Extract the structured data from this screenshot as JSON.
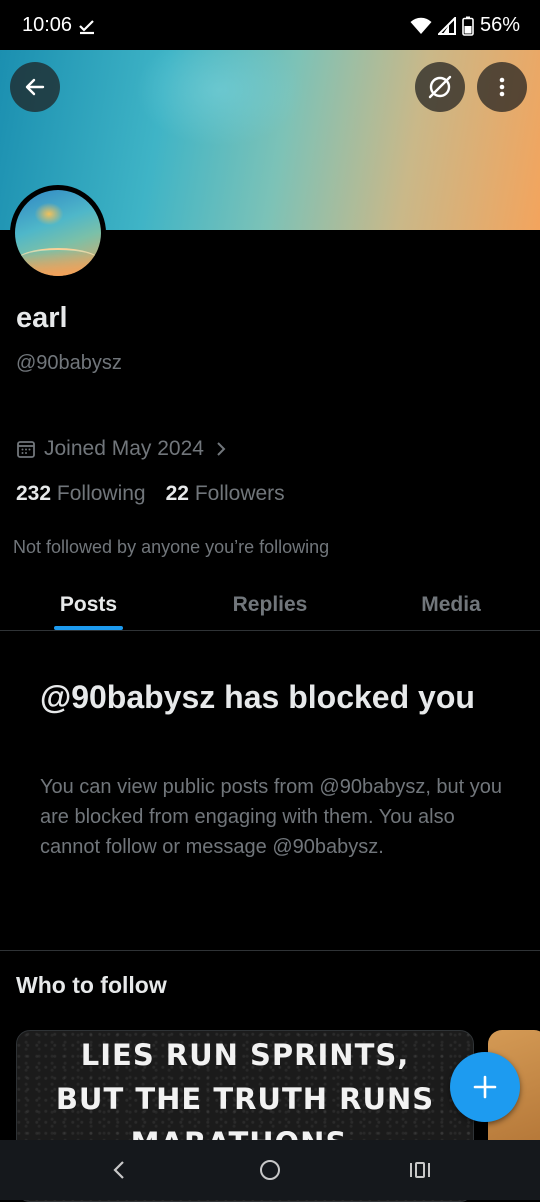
{
  "status_bar": {
    "time": "10:06",
    "battery": "56%"
  },
  "profile": {
    "name": "earl",
    "handle": "@90babysz",
    "joined": "Joined May 2024",
    "following_count": "232",
    "following_label": "Following",
    "followers_count": "22",
    "followers_label": "Followers",
    "not_followed": "Not followed by anyone you’re following"
  },
  "tabs": [
    {
      "label": "Posts",
      "active": true
    },
    {
      "label": "Replies",
      "active": false
    },
    {
      "label": "Media",
      "active": false
    }
  ],
  "blocked": {
    "title": "@90babysz has blocked you",
    "body": "You can view public posts from @90babysz, but you are blocked from engaging with them. You also cannot follow or message @90babysz."
  },
  "who_to_follow": {
    "heading": "Who to follow",
    "card_text_line1": "LIES RUN SPRINTS,",
    "card_text_line2": "BUT THE TRUTH RUNS",
    "card_text_line3": "MARATHONS."
  },
  "icons": {
    "back": "arrow-left-icon",
    "hide": "eye-slash-icon",
    "more": "more-vertical-icon",
    "calendar": "calendar-icon",
    "chevron": "chevron-right-icon",
    "compose": "plus-icon"
  },
  "colors": {
    "accent": "#1d9bf0",
    "text_primary": "#e7e9ea",
    "text_secondary": "#71767b",
    "background": "#000000"
  }
}
